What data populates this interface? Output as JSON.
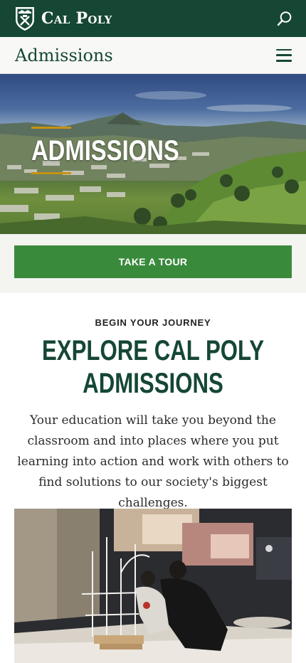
{
  "header": {
    "brand": "Cal Poly",
    "search_icon": "search-icon"
  },
  "subnav": {
    "title": "Admissions",
    "menu_icon": "hamburger-menu-icon"
  },
  "hero": {
    "title": "ADMISSIONS",
    "accent_color": "#c69214"
  },
  "cta": {
    "tour_label": "TAKE A TOUR"
  },
  "journey": {
    "eyebrow": "BEGIN YOUR JOURNEY",
    "headline_line1": "EXPLORE CAL POLY",
    "headline_line2": "ADMISSIONS",
    "body": "Your education will take you beyond the classroom and into places where you put learning into action and work with others to find solutions to our society's biggest challenges."
  },
  "colors": {
    "brand_green": "#154734",
    "button_green": "#3a8a3c",
    "gold": "#c69214"
  }
}
